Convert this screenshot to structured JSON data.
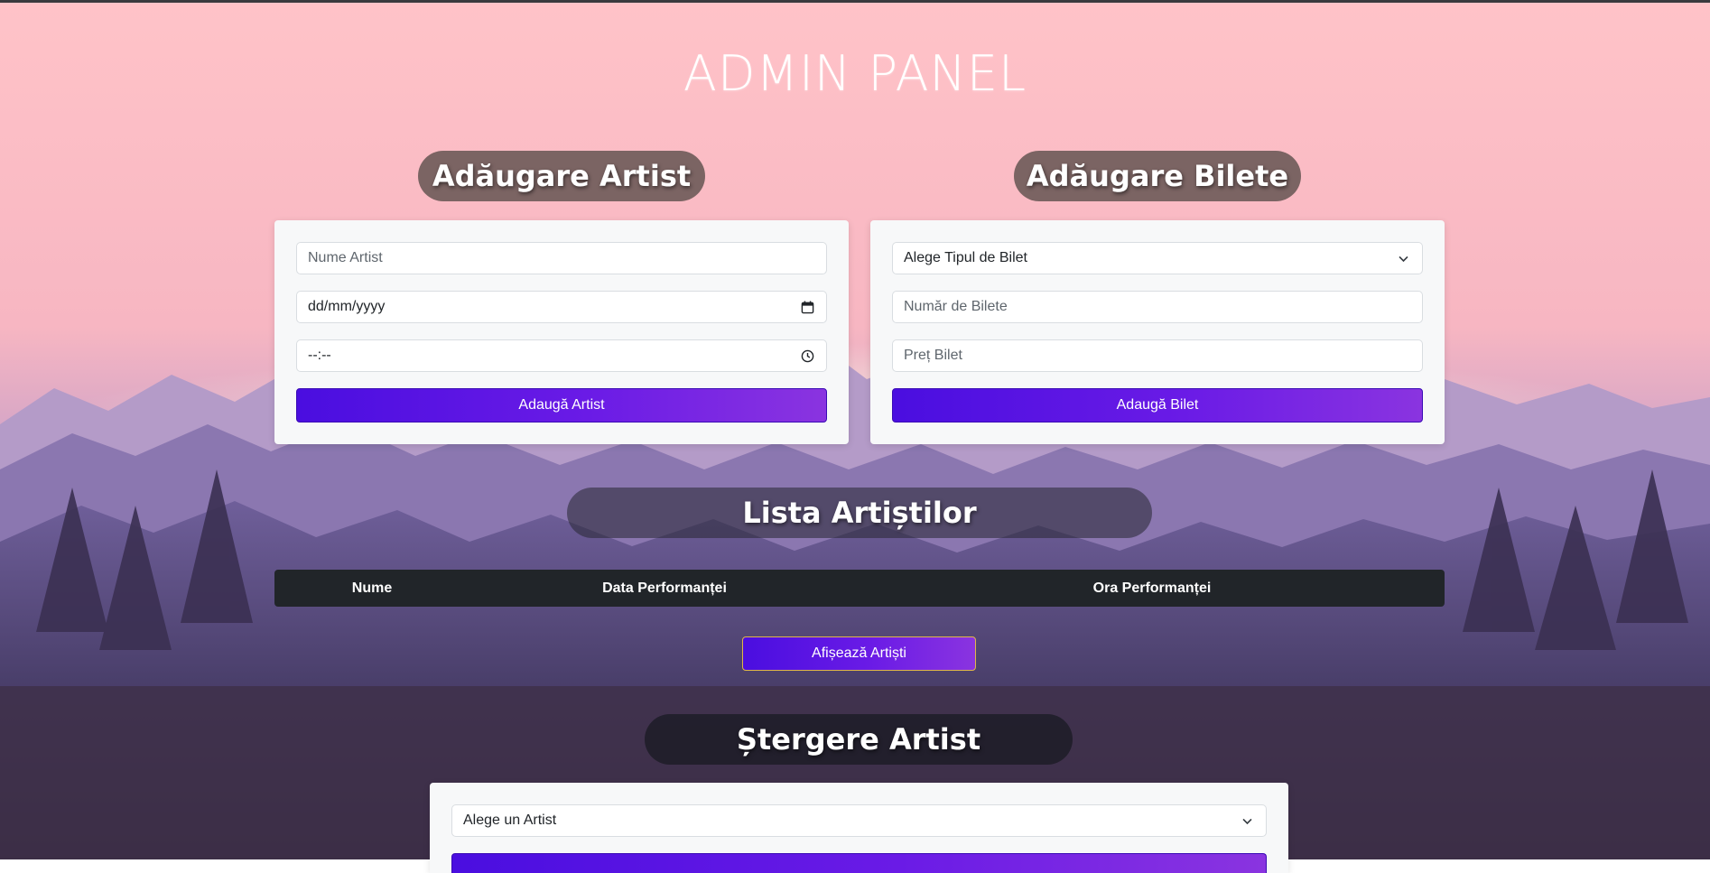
{
  "page": {
    "title": "ADMIN PANEL"
  },
  "add_artist": {
    "heading": "Adăugare Artist",
    "name_placeholder": "Nume Artist",
    "date_placeholder": "dd/mm/yyyy",
    "time_placeholder": "--:--",
    "submit_label": "Adaugă Artist"
  },
  "add_tickets": {
    "heading": "Adăugare Bilete",
    "type_select_value": "Alege Tipul de Bilet",
    "count_placeholder": "Număr de Bilete",
    "price_placeholder": "Preț Bilet",
    "submit_label": "Adaugă Bilet"
  },
  "artist_list": {
    "heading": "Lista Artiștilor",
    "columns": [
      "Nume",
      "Data Performanței",
      "Ora Performanței"
    ],
    "show_button_label": "Afișează Artiști"
  },
  "delete_artist": {
    "heading": "Ștergere Artist",
    "select_value": "Alege un Artist"
  },
  "colors": {
    "accent_start": "#4a0ee0",
    "accent_end": "#8a34e0",
    "table_header": "#212529",
    "heading_pill": "#705c5a"
  },
  "icons": [
    "calendar-icon",
    "clock-icon",
    "chevron-down-icon"
  ]
}
